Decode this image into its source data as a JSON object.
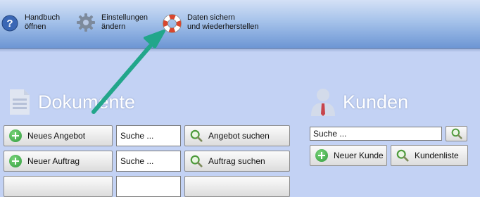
{
  "toolbar": {
    "handbuch": {
      "line1": "Handbuch",
      "line2": "öffnen"
    },
    "einstellungen": {
      "line1": "Einstellungen",
      "line2": "ändern"
    },
    "sichern": {
      "line1": "Daten sichern",
      "line2": "und wiederherstellen"
    }
  },
  "dokumente": {
    "title": "Dokumente",
    "rows": [
      {
        "new_label": "Neues Angebot",
        "search_value": "Suche ...",
        "search_label": "Angebot suchen"
      },
      {
        "new_label": "Neuer Auftrag",
        "search_value": "Suche ...",
        "search_label": "Auftrag suchen"
      }
    ]
  },
  "kunden": {
    "title": "Kunden",
    "search_value": "Suche ...",
    "new_label": "Neuer Kunde",
    "list_label": "Kundenliste"
  },
  "colors": {
    "background": "#c3d2f4",
    "arrow": "#22a68a",
    "plus_green": "#2f9a3c"
  },
  "icons": [
    "help-icon",
    "gear-icon",
    "lifebuoy-icon",
    "document-icon",
    "person-icon",
    "plus-icon",
    "magnifier-icon"
  ]
}
